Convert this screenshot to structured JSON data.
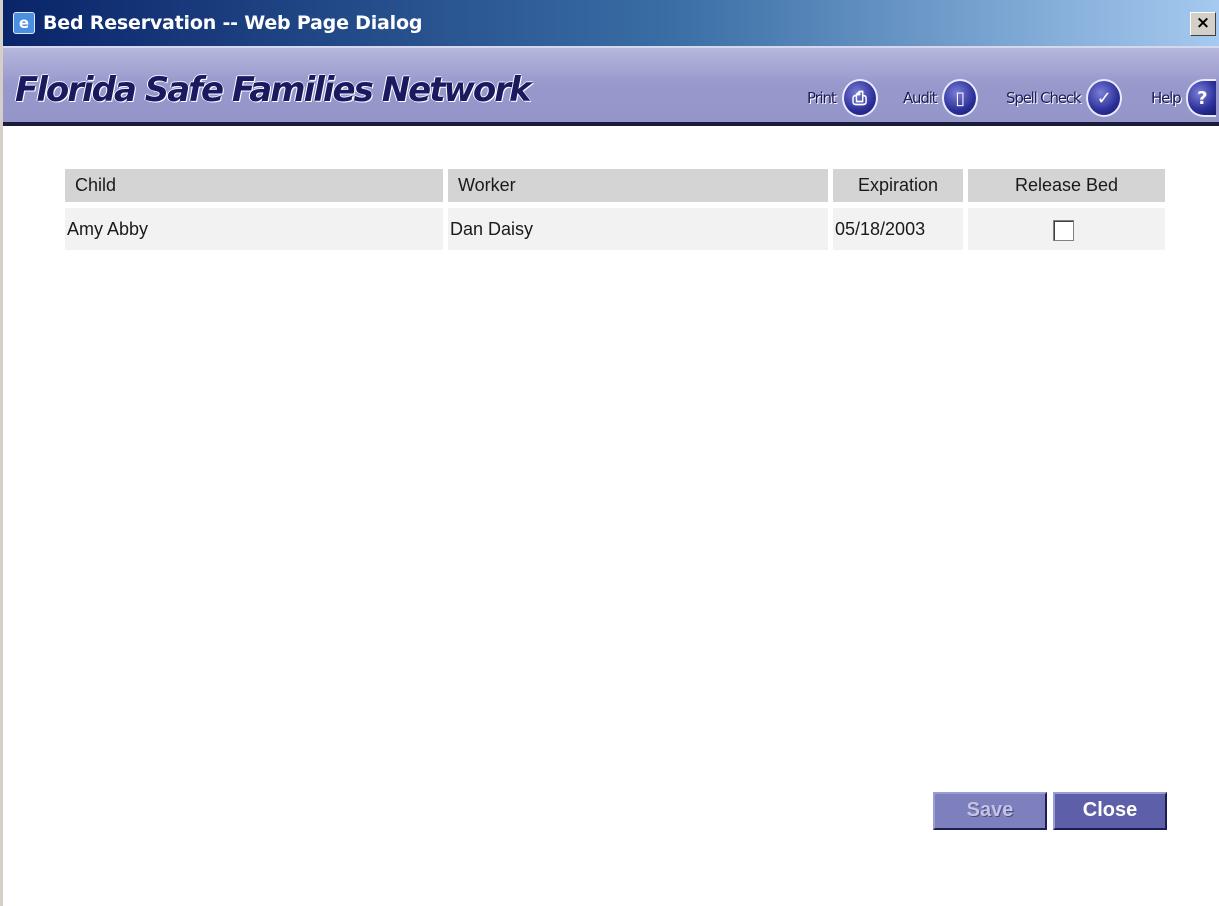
{
  "window": {
    "title": "Bed Reservation -- Web Page Dialog",
    "close_glyph": "×"
  },
  "banner": {
    "brand": "Florida Safe Families Network",
    "tools": [
      {
        "label": "Print",
        "icon": "printer-icon",
        "glyph": "⎙"
      },
      {
        "label": "Audit",
        "icon": "document-icon",
        "glyph": "▯"
      },
      {
        "label": "Spell Check",
        "icon": "spell-check-icon",
        "glyph": "✓"
      },
      {
        "label": "Help",
        "icon": "help-icon",
        "glyph": "?"
      }
    ]
  },
  "table": {
    "columns": [
      "Child",
      "Worker",
      "Expiration",
      "Release Bed"
    ],
    "rows": [
      {
        "child": "Amy Abby",
        "worker": "Dan Daisy",
        "expiration": "05/18/2003",
        "release_bed": false
      }
    ]
  },
  "buttons": {
    "save": "Save",
    "close": "Close"
  },
  "colors": {
    "title_bar": "#0a246a",
    "banner": "#9798cb",
    "button": "#5d5fa9",
    "header_cell": "#d4d4d4"
  }
}
